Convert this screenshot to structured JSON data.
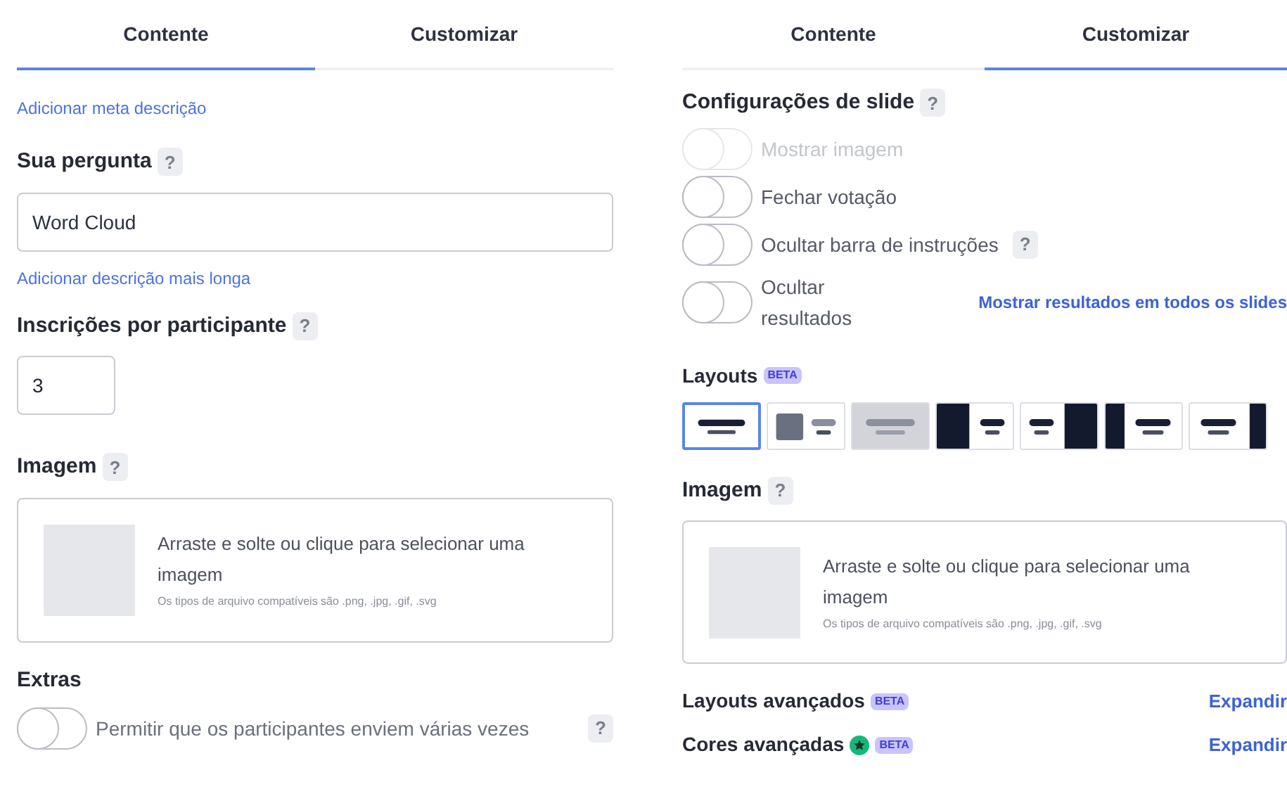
{
  "left_panel": {
    "tabs": [
      {
        "label": "Contente",
        "selected": true
      },
      {
        "label": "Customizar",
        "selected": false
      }
    ],
    "meta_link": "Adicionar meta descrição",
    "question": {
      "label": "Sua pergunta",
      "help": "?",
      "value": "Word Cloud"
    },
    "long_description_link": "Adicionar descrição mais longa",
    "entries": {
      "label": "Inscrições por participante",
      "help": "?",
      "value": "3"
    },
    "image": {
      "label": "Imagem",
      "help": "?",
      "prompt": "Arraste e solte ou clique para selecionar uma imagem",
      "formats": "Os tipos de arquivo compatíveis são .png, .jpg, .gif, .svg"
    },
    "extras": {
      "label": "Extras",
      "toggle": {
        "label": "Permitir que os participantes enviem várias vezes",
        "on": false,
        "help": "?"
      }
    }
  },
  "right_panel": {
    "tabs": [
      {
        "label": "Contente",
        "selected": false
      },
      {
        "label": "Customizar",
        "selected": true
      }
    ],
    "slide_settings": {
      "label": "Configurações de slide",
      "help": "?",
      "toggles": [
        {
          "label": "Mostrar imagem",
          "on": false,
          "disabled": true
        },
        {
          "label": "Fechar votação",
          "on": false,
          "disabled": false
        },
        {
          "label": "Ocultar barra de instruções",
          "on": false,
          "disabled": false,
          "help": "?"
        },
        {
          "label": "Ocultar resultados",
          "on": false,
          "disabled": false,
          "link": "Mostrar resultados em todos os slides"
        }
      ]
    },
    "layouts": {
      "label": "Layouts",
      "badge": "BETA",
      "options": [
        {
          "kind": "text",
          "selected": true,
          "disabled": false
        },
        {
          "kind": "thumb",
          "selected": false,
          "disabled": false
        },
        {
          "kind": "background",
          "selected": false,
          "disabled": true
        },
        {
          "kind": "split-left",
          "selected": false,
          "disabled": false
        },
        {
          "kind": "split-right",
          "selected": false,
          "disabled": false
        },
        {
          "kind": "bar-left",
          "selected": false,
          "disabled": false
        },
        {
          "kind": "bar-right",
          "selected": false,
          "disabled": false
        }
      ]
    },
    "image": {
      "label": "Imagem",
      "help": "?",
      "prompt": "Arraste e solte ou clique para selecionar uma imagem",
      "formats": "Os tipos de arquivo compatíveis são .png, .jpg, .gif, .svg"
    },
    "advanced": [
      {
        "label": "Layouts avançados",
        "badge": "BETA",
        "premium": false,
        "action": "Expandir"
      },
      {
        "label": "Cores avançadas",
        "badge": "BETA",
        "premium": true,
        "action": "Expandir"
      }
    ]
  }
}
